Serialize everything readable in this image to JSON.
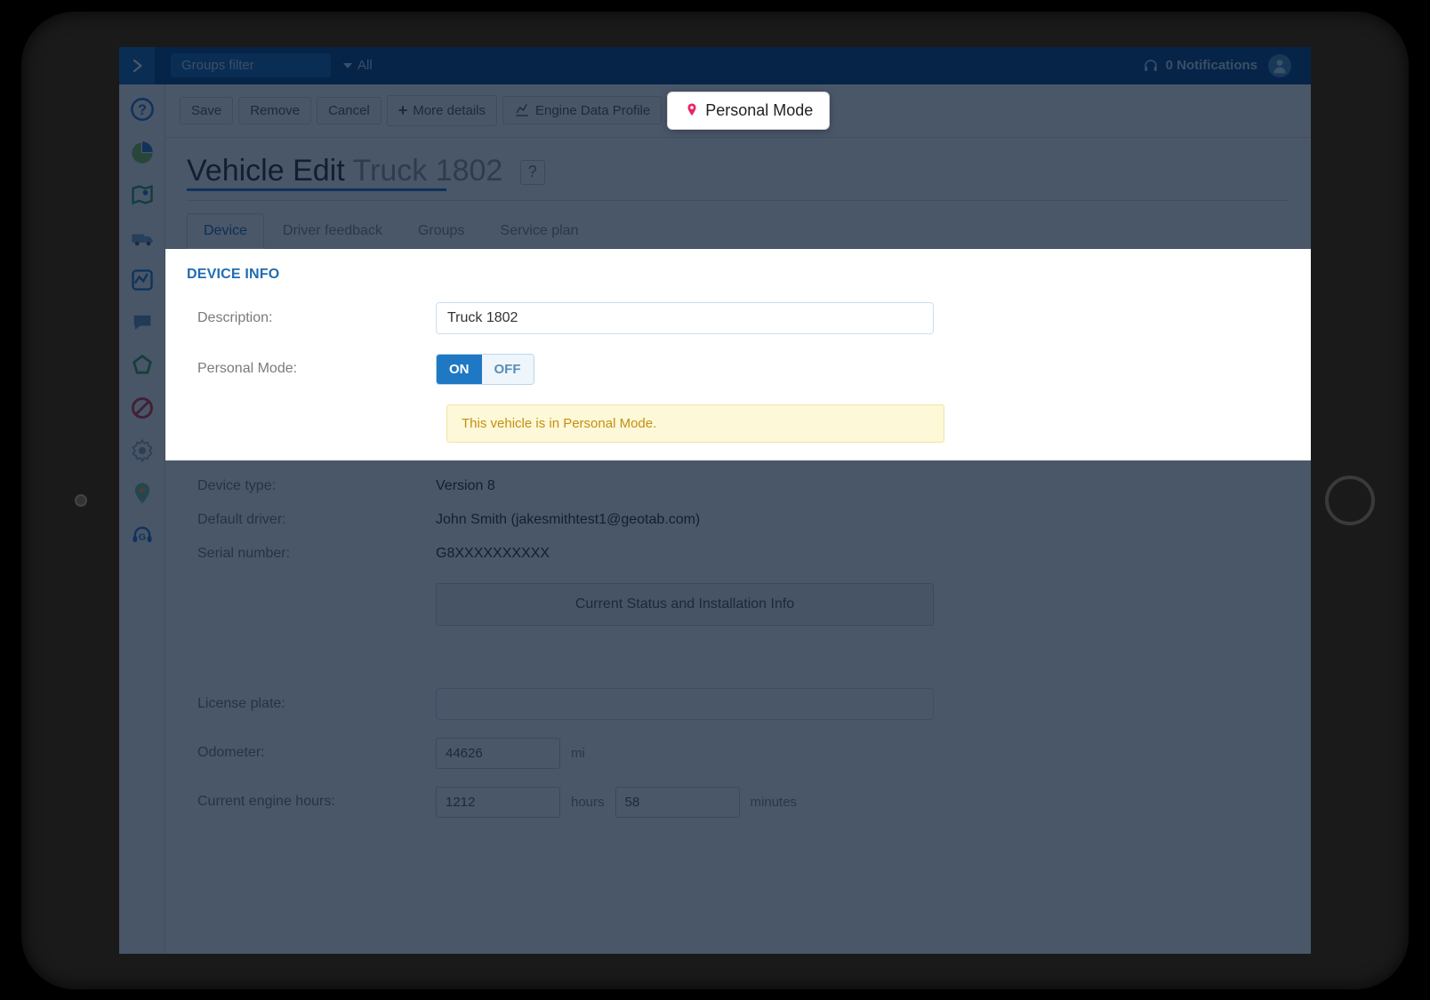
{
  "topbar": {
    "groups_filter": "Groups filter",
    "all": "All",
    "notifications": "0 Notifications"
  },
  "toolbar": {
    "save": "Save",
    "remove": "Remove",
    "cancel": "Cancel",
    "more_details": "More details",
    "engine_data": "Engine Data Profile",
    "personal_mode": "Personal Mode"
  },
  "page": {
    "title_left": "Vehicle Edit ",
    "title_sub": "Truck 1802",
    "help": "?"
  },
  "tabs": {
    "device": "Device",
    "driver_feedback": "Driver feedback",
    "groups": "Groups",
    "service_plan": "Service plan"
  },
  "device_info": {
    "section": "DEVICE INFO",
    "description_label": "Description:",
    "description_value": "Truck 1802",
    "personal_mode_label": "Personal Mode:",
    "on": "ON",
    "off": "OFF",
    "note": "This vehicle is in Personal Mode.",
    "device_type_label": "Device type:",
    "device_type_value": "Version 8",
    "default_driver_label": "Default driver:",
    "default_driver_value": "John Smith (jakesmithtest1@geotab.com)",
    "serial_label": "Serial number:",
    "serial_value": "G8XXXXXXXXXX",
    "status_button": "Current Status and Installation Info",
    "license_label": "License plate:",
    "license_value": "",
    "odometer_label": "Odometer:",
    "odometer_value": "44626",
    "odometer_unit": "mi",
    "engine_hours_label": "Current engine hours:",
    "engine_hours_h": "1212",
    "engine_hours_h_unit": "hours",
    "engine_hours_m": "58",
    "engine_hours_m_unit": "minutes"
  }
}
